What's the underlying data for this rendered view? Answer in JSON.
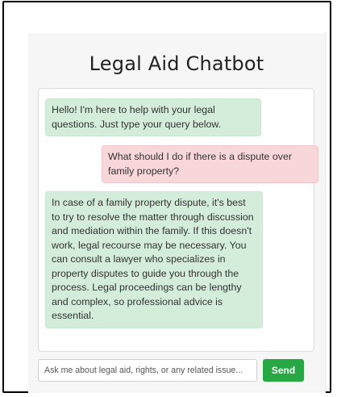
{
  "app": {
    "title": "Legal Aid Chatbot"
  },
  "messages": [
    {
      "role": "bot",
      "text": "Hello! I'm here to help with your legal questions. Just type your query below."
    },
    {
      "role": "user",
      "text": "What should I do if there is a dispute over family property?"
    },
    {
      "role": "bot",
      "text": "In case of a family property dispute, it's best to try to resolve the matter through discussion and mediation within the family. If this doesn't work, legal recourse may be necessary. You can consult a lawyer who specializes in property disputes to guide you through the process. Legal proceedings can be lengthy and complex, so professional advice is essential."
    }
  ],
  "input": {
    "placeholder": "Ask me about legal aid, rights, or any related issue...",
    "value": ""
  },
  "send_button": {
    "label": "Send"
  },
  "colors": {
    "bot_bubble": "#d4edda",
    "user_bubble": "#f8d7da",
    "send_button": "#28a745"
  }
}
